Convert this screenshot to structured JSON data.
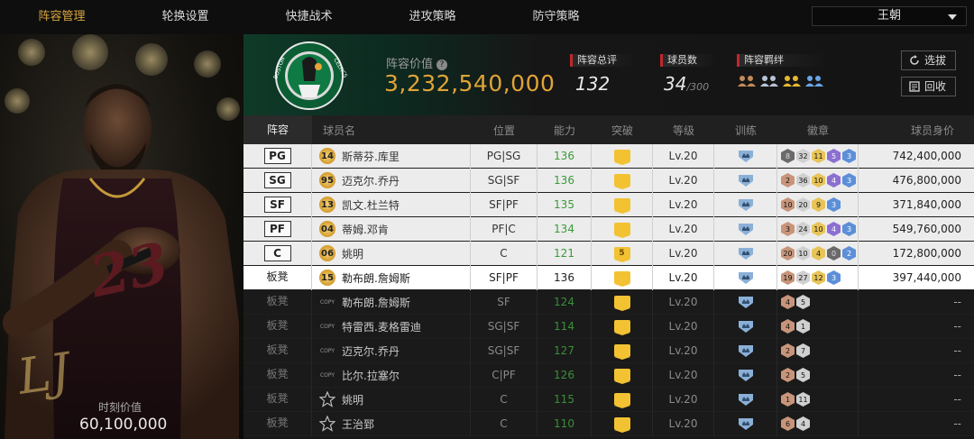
{
  "nav": {
    "tabs": [
      "阵容管理",
      "轮换设置",
      "快捷战术",
      "进攻策略",
      "防守策略"
    ],
    "active_index": 0,
    "team_selector": "王朝"
  },
  "card": {
    "jersey_number": "23",
    "moment_value_label": "时刻价值",
    "moment_value": "60,100,000"
  },
  "summary": {
    "lineup_value_label": "阵容价值",
    "lineup_value": "3,232,540,000",
    "overall_label": "阵容总评",
    "overall": "132",
    "players_label": "球员数",
    "players_count": "34",
    "players_max": "/300",
    "bonds_label": "阵容羁绊",
    "select_button": "选拔",
    "recycle_button": "回收",
    "logo_text": "BOSTON CELTICS"
  },
  "table": {
    "headers": [
      "阵容",
      "球员名",
      "位置",
      "能力",
      "突破",
      "等级",
      "训练",
      "徽章",
      "球员身价"
    ],
    "rows": [
      {
        "slot": "PG",
        "badge_type": "num",
        "badge": "14",
        "name": "斯蒂芬.库里",
        "pos": "PG|SG",
        "ability": "136",
        "break": "",
        "level": "Lv.20",
        "badges": [
          [
            "b-dark",
            "8"
          ],
          [
            "b-silver",
            "32"
          ],
          [
            "b-gold",
            "11"
          ],
          [
            "b-purple",
            "5"
          ],
          [
            "b-blue",
            "3"
          ]
        ],
        "value": "742,400,000"
      },
      {
        "slot": "SG",
        "badge_type": "num",
        "badge": "95",
        "name": "迈克尔.乔丹",
        "pos": "SG|SF",
        "ability": "136",
        "break": "",
        "level": "Lv.20",
        "badges": [
          [
            "b-bronze",
            "2"
          ],
          [
            "b-silver",
            "36"
          ],
          [
            "b-gold",
            "10"
          ],
          [
            "b-purple",
            "4"
          ],
          [
            "b-blue",
            "3"
          ]
        ],
        "value": "476,800,000"
      },
      {
        "slot": "SF",
        "badge_type": "num",
        "badge": "13",
        "name": "凯文.杜兰特",
        "pos": "SF|PF",
        "ability": "135",
        "break": "",
        "level": "Lv.20",
        "badges": [
          [
            "b-bronze",
            "10"
          ],
          [
            "b-silver",
            "20"
          ],
          [
            "b-gold",
            "9"
          ],
          [
            "b-blue",
            "3"
          ]
        ],
        "value": "371,840,000"
      },
      {
        "slot": "PF",
        "badge_type": "num",
        "badge": "04",
        "name": "蒂姆.邓肯",
        "pos": "PF|C",
        "ability": "134",
        "break": "",
        "level": "Lv.20",
        "badges": [
          [
            "b-bronze",
            "3"
          ],
          [
            "b-silver",
            "24"
          ],
          [
            "b-gold",
            "10"
          ],
          [
            "b-purple",
            "4"
          ],
          [
            "b-blue",
            "3"
          ]
        ],
        "value": "549,760,000"
      },
      {
        "slot": "C",
        "badge_type": "num",
        "badge": "06",
        "name": "姚明",
        "pos": "C",
        "ability": "121",
        "break": "5",
        "level": "Lv.20",
        "badges": [
          [
            "b-bronze",
            "20"
          ],
          [
            "b-silver",
            "10"
          ],
          [
            "b-gold",
            "4"
          ],
          [
            "b-dark",
            "0"
          ],
          [
            "b-blue",
            "2"
          ]
        ],
        "value": "172,800,000"
      },
      {
        "slot": "板凳",
        "badge_type": "num",
        "badge": "15",
        "name": "勒布朗.詹姆斯",
        "pos": "SF|PF",
        "ability": "136",
        "break": "",
        "level": "Lv.20",
        "badges": [
          [
            "b-bronze",
            "19"
          ],
          [
            "b-silver",
            "27"
          ],
          [
            "b-gold",
            "12"
          ],
          [
            "b-blue",
            "3"
          ]
        ],
        "value": "397,440,000"
      },
      {
        "slot": "板凳",
        "badge_type": "copy",
        "badge": "COPY",
        "name": "勒布朗.詹姆斯",
        "pos": "SF",
        "ability": "124",
        "break": "",
        "level": "Lv.20",
        "badges": [
          [
            "b-bronze",
            "4"
          ],
          [
            "b-silver",
            "5"
          ]
        ],
        "value": "--"
      },
      {
        "slot": "板凳",
        "badge_type": "copy",
        "badge": "COPY",
        "name": "特雷西.麦格雷迪",
        "pos": "SG|SF",
        "ability": "114",
        "break": "",
        "level": "Lv.20",
        "badges": [
          [
            "b-bronze",
            "4"
          ],
          [
            "b-silver",
            "1"
          ]
        ],
        "value": "--"
      },
      {
        "slot": "板凳",
        "badge_type": "copy",
        "badge": "COPY",
        "name": "迈克尔.乔丹",
        "pos": "SG|SF",
        "ability": "127",
        "break": "",
        "level": "Lv.20",
        "badges": [
          [
            "b-bronze",
            "2"
          ],
          [
            "b-silver",
            "7"
          ]
        ],
        "value": "--"
      },
      {
        "slot": "板凳",
        "badge_type": "copy",
        "badge": "COPY",
        "name": "比尔.拉塞尔",
        "pos": "C|PF",
        "ability": "126",
        "break": "",
        "level": "Lv.20",
        "badges": [
          [
            "b-bronze",
            "2"
          ],
          [
            "b-silver",
            "5"
          ]
        ],
        "value": "--"
      },
      {
        "slot": "板凳",
        "badge_type": "star",
        "badge": "",
        "name": "姚明",
        "pos": "C",
        "ability": "115",
        "break": "",
        "level": "Lv.20",
        "badges": [
          [
            "b-bronze",
            "1"
          ],
          [
            "b-silver",
            "11"
          ]
        ],
        "value": "--"
      },
      {
        "slot": "板凳",
        "badge_type": "star",
        "badge": "",
        "name": "王治郅",
        "pos": "C",
        "ability": "110",
        "break": "",
        "level": "Lv.20",
        "badges": [
          [
            "b-bronze",
            "6"
          ],
          [
            "b-silver",
            "4"
          ]
        ],
        "value": "--"
      }
    ],
    "selected_row": 5
  },
  "colors": {
    "accent": "#d9a640",
    "green": "#3aa43a",
    "red": "#c0272d",
    "gold_value": "#e0a437"
  }
}
